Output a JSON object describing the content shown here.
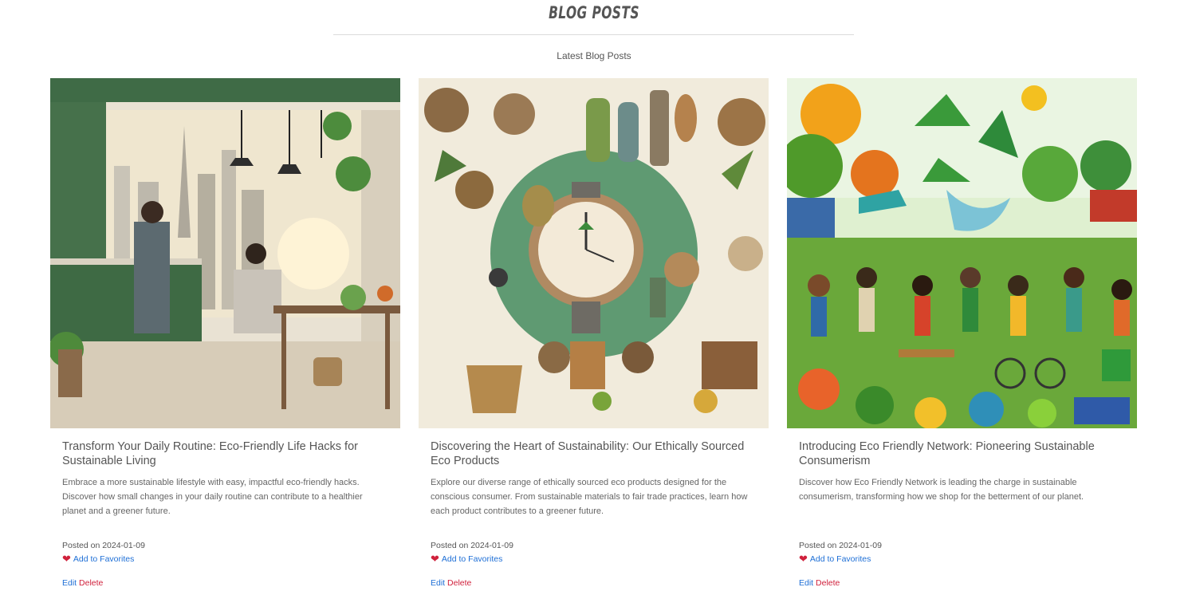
{
  "header": {
    "title": "BLOG POSTS",
    "subtitle": "Latest Blog Posts"
  },
  "posts": [
    {
      "image_alt": "eco kitchen cityscape illustration",
      "title": "Transform Your Daily Routine: Eco-Friendly Life Hacks for Sustainable Living",
      "excerpt": "Embrace a more sustainable lifestyle with easy, impactful eco-friendly hacks. Discover how small changes in your daily routine can contribute to a healthier planet and a greener future.",
      "date": "Posted on 2024-01-09",
      "favorite_label": "Add to Favorites",
      "edit_label": "Edit",
      "delete_label": "Delete"
    },
    {
      "image_alt": "ethically sourced eco products collage",
      "title": "Discovering the Heart of Sustainability: Our Ethically Sourced Eco Products",
      "excerpt": "Explore our diverse range of ethically sourced eco products designed for the conscious consumer. From sustainable materials to fair trade practices, learn how each product contributes to a greener future.",
      "date": "Posted on 2024-01-09",
      "favorite_label": "Add to Favorites",
      "edit_label": "Edit",
      "delete_label": "Delete"
    },
    {
      "image_alt": "eco friendly community market illustration",
      "title": "Introducing Eco Friendly Network: Pioneering Sustainable Consumerism",
      "excerpt": "Discover how Eco Friendly Network is leading the charge in sustainable consumerism, transforming how we shop for the betterment of our planet.",
      "date": "Posted on 2024-01-09",
      "favorite_label": "Add to Favorites",
      "edit_label": "Edit",
      "delete_label": "Delete"
    }
  ],
  "colors": {
    "link": "#1e6fd6",
    "delete": "#d0213c",
    "heart": "#d0213c"
  }
}
